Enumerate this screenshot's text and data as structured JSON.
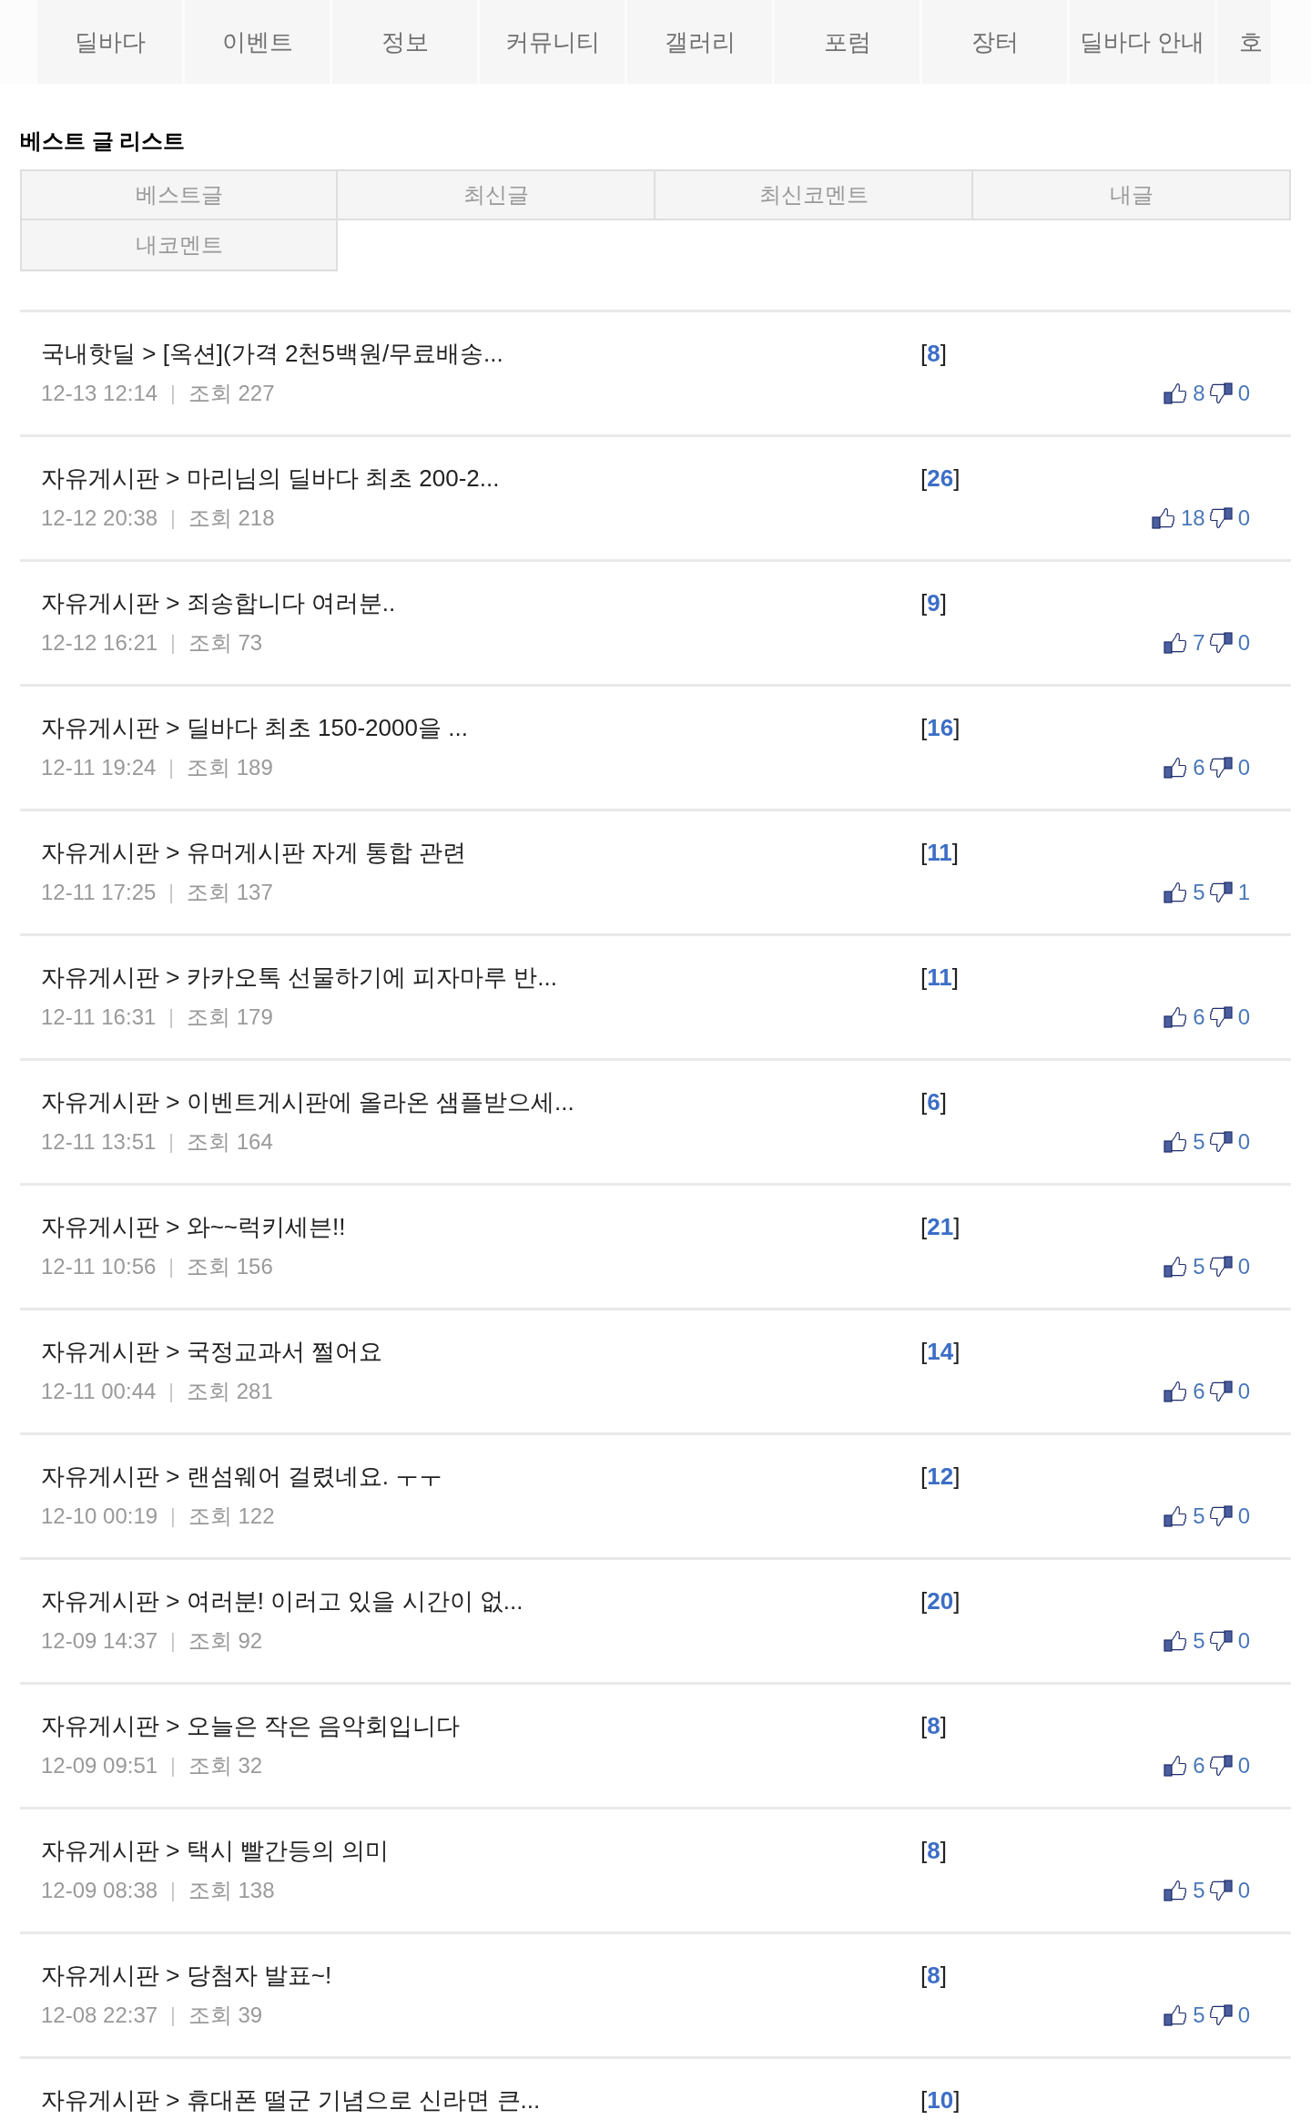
{
  "nav": {
    "items": [
      "딜바다",
      "이벤트",
      "정보",
      "커뮤니티",
      "갤러리",
      "포럼",
      "장터",
      "딜바다 안내",
      "호"
    ]
  },
  "section_title": "베스트 글 리스트",
  "tabs": [
    "베스트글",
    "최신글",
    "최신코멘트",
    "내글",
    "내코멘트"
  ],
  "posts": [
    {
      "title": "국내핫딜 > [옥션](가격 2천5백원/무료배송...",
      "comments": "[**8**]",
      "date": "12-13 12:14",
      "separator": "|",
      "views": "조회 227",
      "likes": "8",
      "dislikes": "0"
    },
    {
      "title": "자유게시판 > 마리님의 딜바다 최초 200-2...",
      "comments": "[**26**]",
      "date": "12-12 20:38",
      "separator": "|",
      "views": "조회 218",
      "likes": "18",
      "dislikes": "0"
    },
    {
      "title": "자유게시판 > 죄송합니다 여러분..",
      "comments": "[**9**]",
      "date": "12-12 16:21",
      "separator": "|",
      "views": "조회 73",
      "likes": "7",
      "dislikes": "0"
    },
    {
      "title": "자유게시판 > 딜바다 최초 150-2000을 ...",
      "comments": "[**16**]",
      "date": "12-11 19:24",
      "separator": "|",
      "views": "조회 189",
      "likes": "6",
      "dislikes": "0"
    },
    {
      "title": "자유게시판 > 유머게시판 자게 통합 관련",
      "comments": "[**11**]",
      "date": "12-11 17:25",
      "separator": "|",
      "views": "조회 137",
      "likes": "5",
      "dislikes": "1"
    },
    {
      "title": "자유게시판 > 카카오톡 선물하기에 피자마루 반...",
      "comments": "[**11**]",
      "date": "12-11 16:31",
      "separator": "|",
      "views": "조회 179",
      "likes": "6",
      "dislikes": "0"
    },
    {
      "title": "자유게시판 > 이벤트게시판에 올라온 샘플받으세...",
      "comments": "[**6**]",
      "date": "12-11 13:51",
      "separator": "|",
      "views": "조회 164",
      "likes": "5",
      "dislikes": "0"
    },
    {
      "title": "자유게시판 > 와~~럭키세븐!!",
      "comments": "[**21**]",
      "date": "12-11 10:56",
      "separator": "|",
      "views": "조회 156",
      "likes": "5",
      "dislikes": "0"
    },
    {
      "title": "자유게시판 > 국정교과서 쩔어요",
      "comments": "[**14**]",
      "date": "12-11 00:44",
      "separator": "|",
      "views": "조회 281",
      "likes": "6",
      "dislikes": "0"
    },
    {
      "title": "자유게시판 > 랜섬웨어 걸렸네요. ㅜㅜ",
      "comments": "[**12**]",
      "date": "12-10 00:19",
      "separator": "|",
      "views": "조회 122",
      "likes": "5",
      "dislikes": "0"
    },
    {
      "title": "자유게시판 > 여러분! 이러고 있을 시간이 없...",
      "comments": "[**20**]",
      "date": "12-09 14:37",
      "separator": "|",
      "views": "조회 92",
      "likes": "5",
      "dislikes": "0"
    },
    {
      "title": "자유게시판 > 오늘은 작은 음악회입니다",
      "comments": "[**8**]",
      "date": "12-09 09:51",
      "separator": "|",
      "views": "조회 32",
      "likes": "6",
      "dislikes": "0"
    },
    {
      "title": "자유게시판 > 택시 빨간등의 의미",
      "comments": "[**8**]",
      "date": "12-09 08:38",
      "separator": "|",
      "views": "조회 138",
      "likes": "5",
      "dislikes": "0"
    },
    {
      "title": "자유게시판 > 당첨자 발표~!",
      "comments": "[**8**]",
      "date": "12-08 22:37",
      "separator": "|",
      "views": "조회 39",
      "likes": "5",
      "dislikes": "0"
    },
    {
      "title": "자유게시판 > 휴대폰 떨군 기념으로 신라면 큰...",
      "comments": "[**10**]"
    }
  ]
}
